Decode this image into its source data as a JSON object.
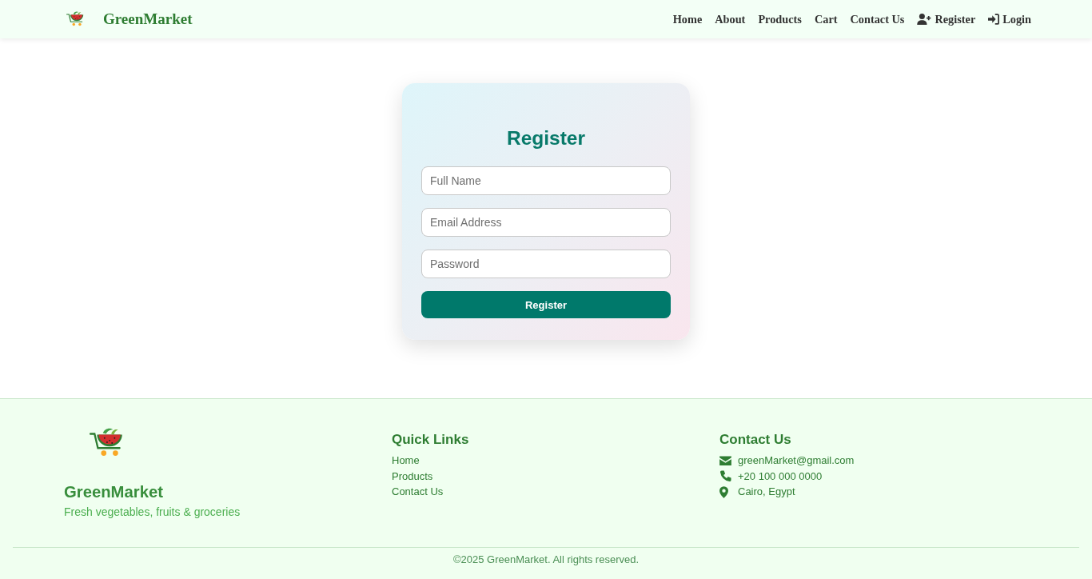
{
  "header": {
    "brand": "GreenMarket",
    "nav": [
      {
        "label": "Home",
        "kind": "link"
      },
      {
        "label": "About",
        "kind": "link"
      },
      {
        "label": "Products",
        "kind": "link"
      },
      {
        "label": "Cart",
        "kind": "link"
      },
      {
        "label": "Contact Us",
        "kind": "link"
      },
      {
        "label": "Register",
        "kind": "signup"
      },
      {
        "label": "Login",
        "kind": "signin"
      }
    ]
  },
  "register_form": {
    "title": "Register",
    "fields": [
      {
        "placeholder": "Full Name"
      },
      {
        "placeholder": "Email Address"
      },
      {
        "placeholder": "Password"
      }
    ],
    "submit": "Register"
  },
  "footer": {
    "brand": "GreenMarket",
    "tagline": "Fresh vegetables, fruits & groceries",
    "quick_links": {
      "title": "Quick Links",
      "items": [
        "Home",
        "Products",
        "Contact Us"
      ]
    },
    "contact": {
      "title": "Contact Us",
      "items": [
        {
          "kind": "email",
          "text": "greenMarket@gmail.com"
        },
        {
          "kind": "phone",
          "text": "+20 100 000 0000"
        },
        {
          "kind": "location",
          "text": "Cairo, Egypt"
        }
      ]
    },
    "copyright": "©2025 GreenMarket. All rights reserved."
  }
}
